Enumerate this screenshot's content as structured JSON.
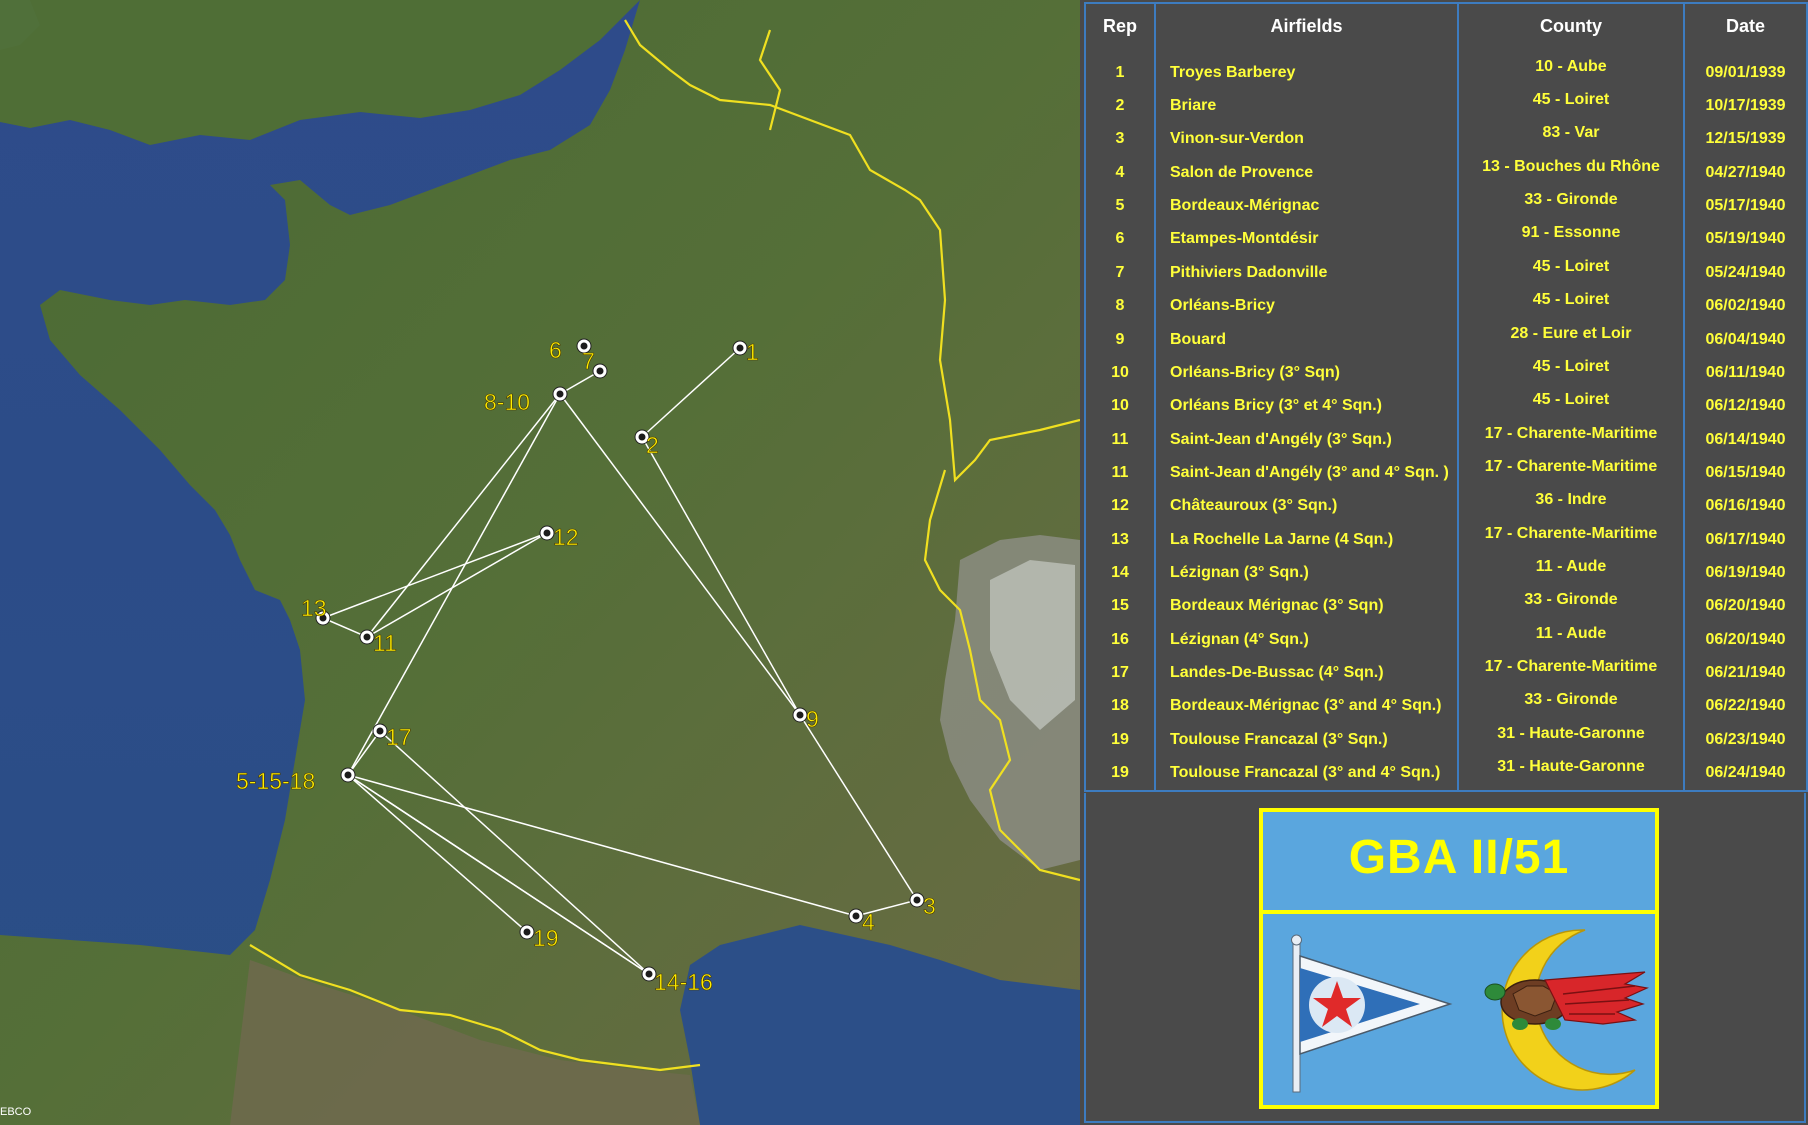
{
  "map": {
    "credit": "EBCO",
    "markers": [
      {
        "label": "1"
      },
      {
        "label": "2"
      },
      {
        "label": "3"
      },
      {
        "label": "4"
      },
      {
        "label": "5-15-18"
      },
      {
        "label": "6"
      },
      {
        "label": "7"
      },
      {
        "label": "8-10"
      },
      {
        "label": "9"
      },
      {
        "label": "11"
      },
      {
        "label": "12"
      },
      {
        "label": "13"
      },
      {
        "label": "14-16"
      },
      {
        "label": "17"
      },
      {
        "label": "19"
      }
    ]
  },
  "table": {
    "headers": {
      "rep": "Rep",
      "airfields": "Airfields",
      "county": "County",
      "date": "Date"
    },
    "rows": [
      {
        "rep": "1",
        "airfield": "Troyes Barberey",
        "county": "10 - Aube",
        "date": "09/01/1939"
      },
      {
        "rep": "2",
        "airfield": "Briare",
        "county": "45 - Loiret",
        "date": "10/17/1939"
      },
      {
        "rep": "3",
        "airfield": "Vinon-sur-Verdon",
        "county": "83 - Var",
        "date": "12/15/1939"
      },
      {
        "rep": "4",
        "airfield": "Salon de Provence",
        "county": "13 - Bouches du Rhône",
        "date": "04/27/1940"
      },
      {
        "rep": "5",
        "airfield": "Bordeaux-Mérignac",
        "county": "33 - Gironde",
        "date": "05/17/1940"
      },
      {
        "rep": "6",
        "airfield": "Etampes-Montdésir",
        "county": "91 - Essonne",
        "date": "05/19/1940"
      },
      {
        "rep": "7",
        "airfield": "Pithiviers Dadonville",
        "county": "45 - Loiret",
        "date": "05/24/1940"
      },
      {
        "rep": "8",
        "airfield": "Orléans-Bricy",
        "county": "45 - Loiret",
        "date": "06/02/1940"
      },
      {
        "rep": "9",
        "airfield": "Bouard",
        "county": "28 - Eure et Loir",
        "date": "06/04/1940"
      },
      {
        "rep": "10",
        "airfield": "Orléans-Bricy (3° Sqn)",
        "county": "45 - Loiret",
        "date": "06/11/1940"
      },
      {
        "rep": "10",
        "airfield": "Orléans Bricy (3° et 4° Sqn.)",
        "county": "45 - Loiret",
        "date": "06/12/1940"
      },
      {
        "rep": "11",
        "airfield": "Saint-Jean d'Angély (3° Sqn.)",
        "county": "17 - Charente-Maritime",
        "date": "06/14/1940"
      },
      {
        "rep": "11",
        "airfield": "Saint-Jean d'Angély (3° and 4° Sqn. )",
        "county": "17 - Charente-Maritime",
        "date": "06/15/1940"
      },
      {
        "rep": "12",
        "airfield": "Châteauroux (3° Sqn.)",
        "county": "36 - Indre",
        "date": "06/16/1940"
      },
      {
        "rep": "13",
        "airfield": "La Rochelle La Jarne (4 Sqn.)",
        "county": "17 - Charente-Maritime",
        "date": "06/17/1940"
      },
      {
        "rep": "14",
        "airfield": "Lézignan (3° Sqn.)",
        "county": "11 - Aude",
        "date": "06/19/1940"
      },
      {
        "rep": "15",
        "airfield": "Bordeaux Mérignac (3° Sqn)",
        "county": "33 - Gironde",
        "date": "06/20/1940"
      },
      {
        "rep": "16",
        "airfield": "Lézignan (4° Sqn.)",
        "county": "11 - Aude",
        "date": "06/20/1940"
      },
      {
        "rep": "17",
        "airfield": "Landes-De-Bussac (4° Sqn.)",
        "county": "17 - Charente-Maritime",
        "date": "06/21/1940"
      },
      {
        "rep": "18",
        "airfield": "Bordeaux-Mérignac (3° and 4° Sqn.)",
        "county": "33 - Gironde",
        "date": "06/22/1940"
      },
      {
        "rep": "19",
        "airfield": "Toulouse Francazal (3° Sqn.)",
        "county": "31 - Haute-Garonne",
        "date": "06/23/1940"
      },
      {
        "rep": "19",
        "airfield": "Toulouse Francazal (3° and 4° Sqn.)",
        "county": "31 - Haute-Garonne",
        "date": "06/24/1940"
      }
    ]
  },
  "badge": {
    "title": "GBA II/51",
    "flag_icon": "pennant-flag-red-star-icon",
    "emblem_icon": "crescent-turtle-wing-icon"
  },
  "colors": {
    "panel_bg": "#4a4a4a",
    "table_text": "#ffff3a",
    "header_text": "#ffffff",
    "grid_lines": "#3d7cc0",
    "badge_bg": "#5aa6de",
    "badge_border": "#ffff00",
    "map_label": "#ffee00",
    "route_line": "#ffffff",
    "border_line": "#f0e020"
  }
}
